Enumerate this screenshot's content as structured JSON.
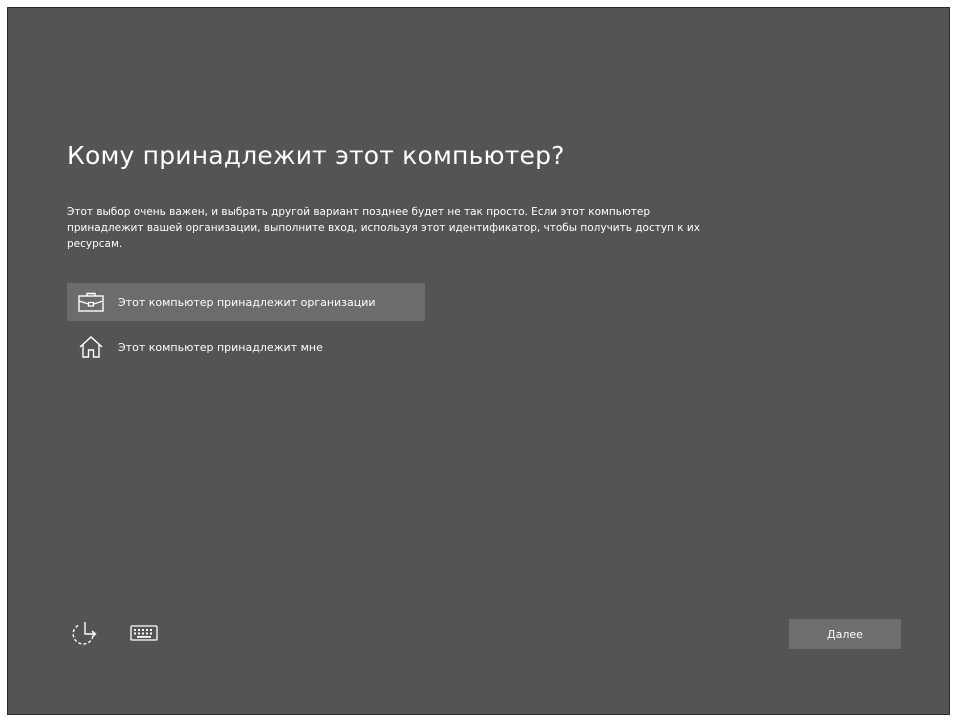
{
  "page": {
    "title": "Кому принадлежит этот компьютер?",
    "description": "Этот выбор очень важен, и выбрать другой вариант позднее будет не так просто. Если этот компьютер принадлежит вашей организации, выполните вход, используя этот идентификатор, чтобы получить доступ к их ресурсам."
  },
  "options": [
    {
      "label": "Этот компьютер принадлежит организации",
      "icon": "briefcase-icon",
      "selected": true
    },
    {
      "label": "Этот компьютер принадлежит мне",
      "icon": "home-icon",
      "selected": false
    }
  ],
  "footer": {
    "accessibility_icon": "ease-of-access-icon",
    "keyboard_icon": "keyboard-icon",
    "next_label": "Далее"
  },
  "colors": {
    "background": "#545454",
    "selected_option": "#6c6c6c",
    "button": "#6e6e6e",
    "text": "#ffffff"
  }
}
